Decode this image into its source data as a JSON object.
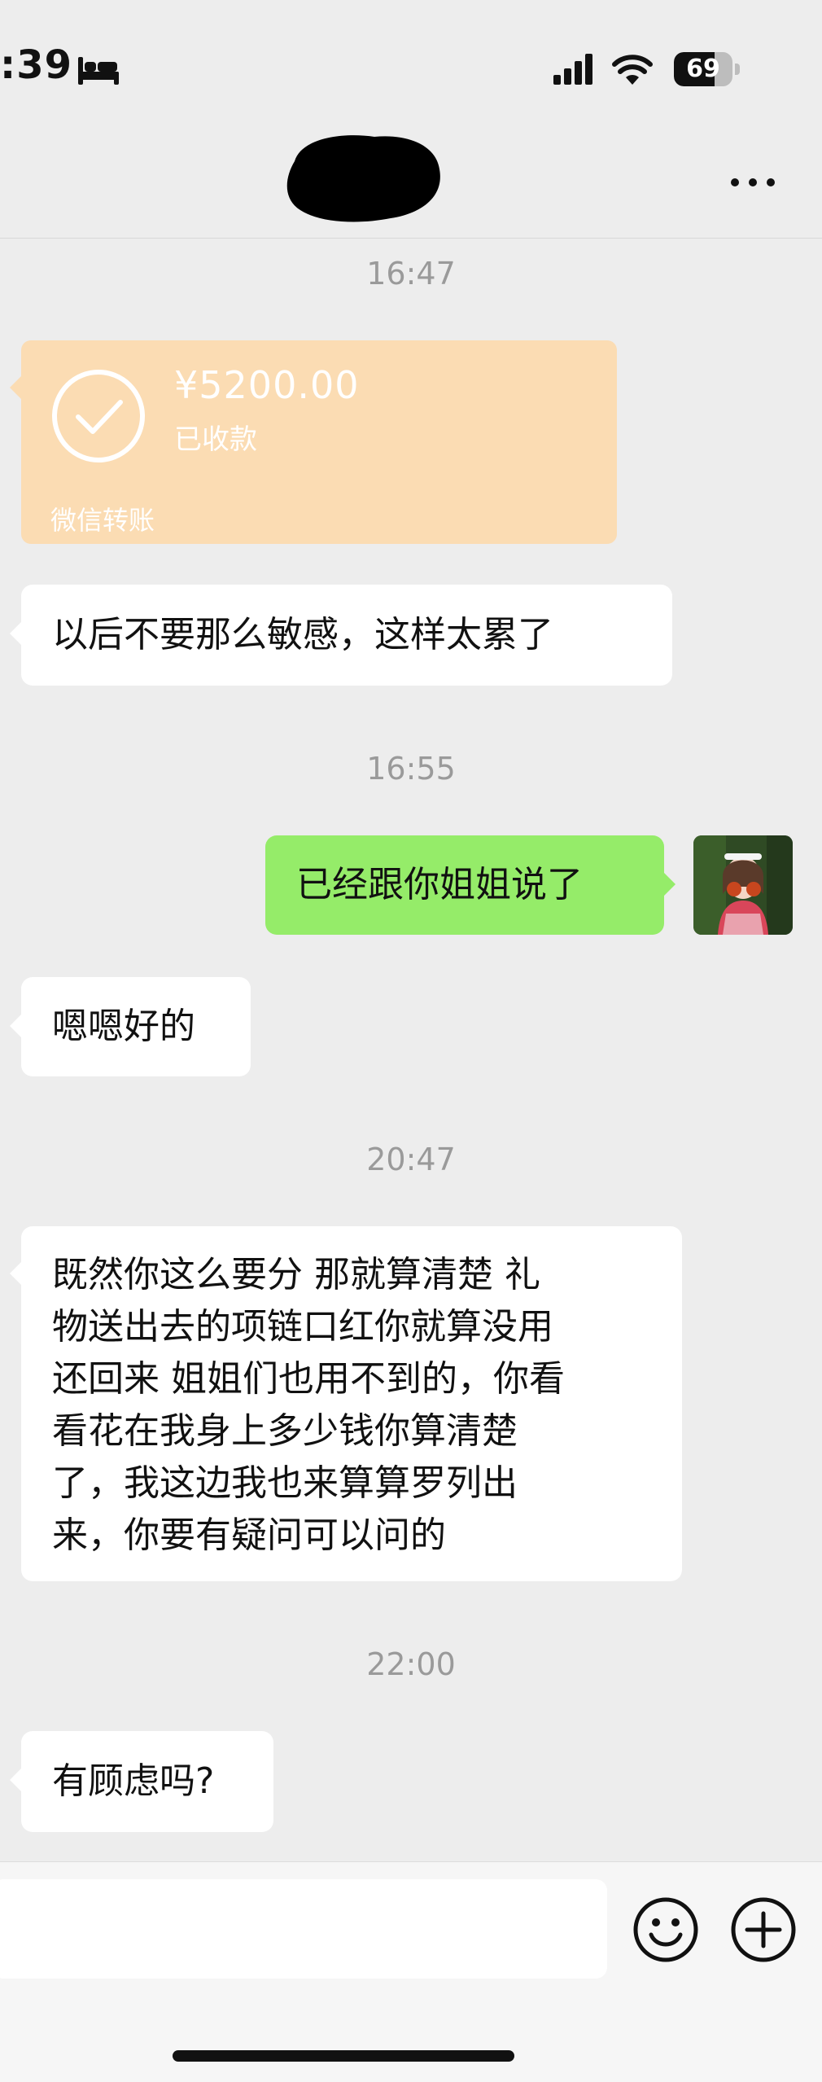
{
  "status_bar": {
    "time": ":39",
    "battery": "69",
    "battery_level": 0.69
  },
  "header": {
    "title": ""
  },
  "messages": [
    {
      "type": "timestamp",
      "text": "16:47"
    },
    {
      "type": "transfer",
      "side": "left",
      "amount": "¥5200.00",
      "status": "已收款",
      "label": "微信转账"
    },
    {
      "type": "text",
      "side": "left",
      "text": "以后不要那么敏感，这样太累了"
    },
    {
      "type": "timestamp",
      "text": "16:55"
    },
    {
      "type": "text",
      "side": "right",
      "text": "已经跟你姐姐说了"
    },
    {
      "type": "text",
      "side": "left",
      "text": "嗯嗯好的"
    },
    {
      "type": "timestamp",
      "text": "20:47"
    },
    {
      "type": "text",
      "side": "left",
      "lines": [
        "既然你这么要分 那就算清楚 礼",
        "物送出去的项链口红你就算没用",
        "还回来 姐姐们也用不到的，你看",
        "看花在我身上多少钱你算清楚",
        "了，我这边我也来算算罗列出",
        "来，你要有疑问可以问的"
      ]
    },
    {
      "type": "timestamp",
      "text": "22:00"
    },
    {
      "type": "text",
      "side": "left",
      "text": "有顾虑吗?"
    }
  ],
  "input": {
    "value": "",
    "placeholder": ""
  },
  "icons": {
    "emoji": "smiley-icon",
    "plus": "plus-circle-icon",
    "more": "more-dots-icon",
    "check": "check-circle-icon"
  },
  "colors": {
    "background": "#ededed",
    "sent_bubble": "#95ec69",
    "received_bubble": "#ffffff",
    "transfer_card": "#fbdcb3"
  }
}
